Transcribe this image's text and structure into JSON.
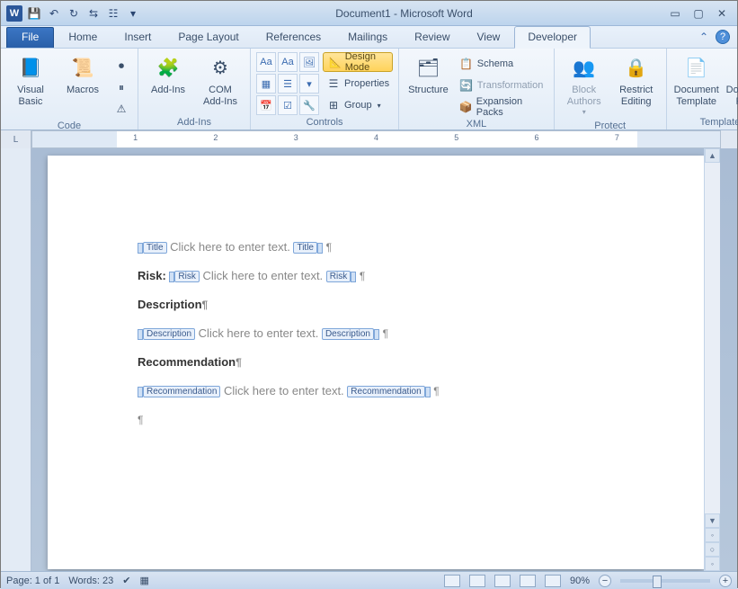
{
  "titlebar": {
    "title": "Document1 - Microsoft Word"
  },
  "tabs": {
    "file": "File",
    "items": [
      "Home",
      "Insert",
      "Page Layout",
      "References",
      "Mailings",
      "Review",
      "View",
      "Developer"
    ],
    "active": "Developer"
  },
  "ribbon": {
    "code": {
      "label": "Code",
      "visual_basic": "Visual\nBasic",
      "macros": "Macros"
    },
    "addins": {
      "label": "Add-Ins",
      "addins": "Add-Ins",
      "com": "COM\nAdd-Ins"
    },
    "controls": {
      "label": "Controls",
      "design_mode": "Design Mode",
      "properties": "Properties",
      "group": "Group"
    },
    "xml": {
      "label": "XML",
      "structure": "Structure",
      "schema": "Schema",
      "transformation": "Transformation",
      "expansion": "Expansion Packs"
    },
    "protect": {
      "label": "Protect",
      "block": "Block\nAuthors",
      "restrict": "Restrict\nEditing"
    },
    "templates": {
      "label": "Templates",
      "doc_template": "Document\nTemplate",
      "doc_panel": "Document\nPanel"
    }
  },
  "ruler_nums": [
    "1",
    "2",
    "3",
    "4",
    "5",
    "6",
    "7"
  ],
  "document": {
    "placeholder": "Click here to enter text.",
    "tags": {
      "title": "Title",
      "risk": "Risk",
      "description": "Description",
      "recommendation": "Recommendation"
    },
    "labels": {
      "risk": "Risk:",
      "description": "Description",
      "recommendation": "Recommendation"
    },
    "pil": "¶"
  },
  "status": {
    "page": "Page: 1 of 1",
    "words": "Words: 23",
    "zoom": "90%"
  }
}
